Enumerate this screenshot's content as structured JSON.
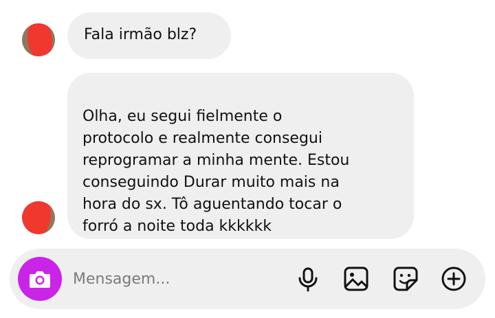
{
  "conversation": {
    "messages": [
      {
        "sender": "incoming",
        "text": "Fala irmão blz?"
      },
      {
        "sender": "incoming",
        "text": "Olha, eu segui fielmente o\nprotocolo e realmente consegui\nreprogramar a minha mente. Estou\nconseguindo Durar muito mais na\nhora do sx.  Tô aguentando tocar o\nforró a noite toda kkkkkk"
      }
    ]
  },
  "composer": {
    "placeholder": "Mensagem...",
    "value": "",
    "icons": [
      "camera-icon",
      "microphone-icon",
      "gallery-icon",
      "sticker-icon",
      "plus-icon"
    ]
  },
  "colors": {
    "bubble_bg": "#efefef",
    "camera_accent": "#c924e8",
    "redaction": "#f0382f"
  }
}
